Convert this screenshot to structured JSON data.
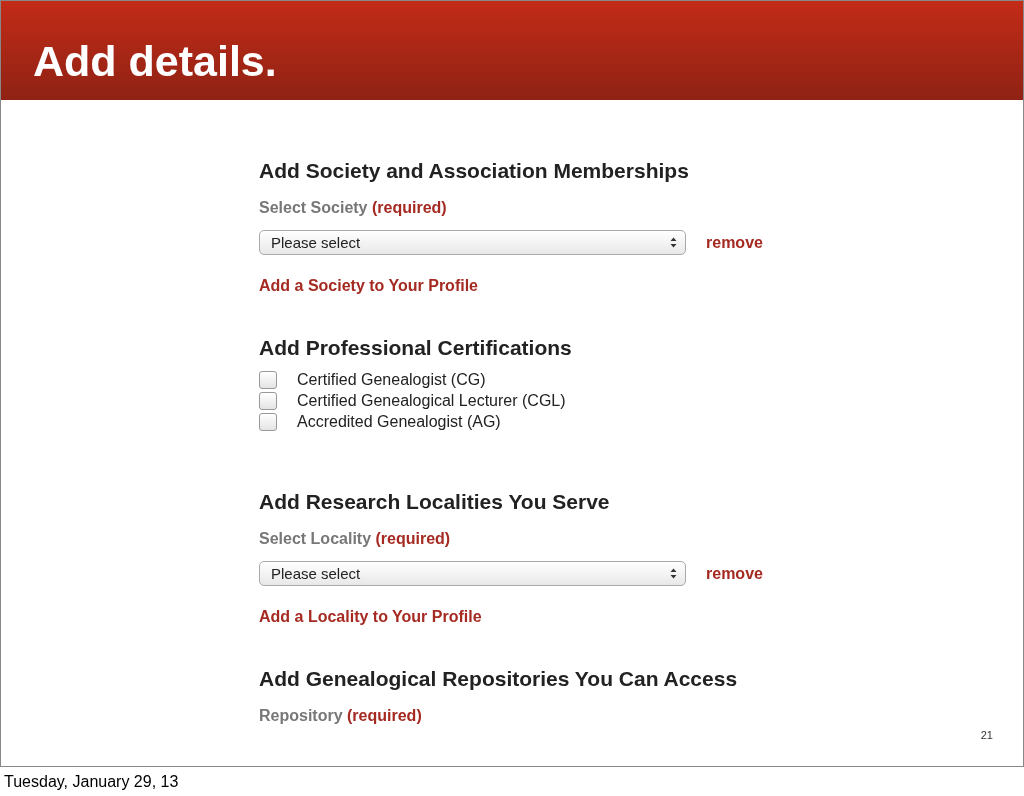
{
  "slide": {
    "title": "Add details.",
    "page_number": "21"
  },
  "sections": [
    {
      "kind": "select",
      "heading": "Add Society and Association Memberships",
      "label": "Select Society",
      "required": "(required)",
      "select": "Please select",
      "remove": "remove",
      "add_link": "Add a Society to Your Profile"
    },
    {
      "kind": "checkboxes",
      "heading": "Add Professional Certifications",
      "items": [
        {
          "label": "Certified Genealogist (CG)",
          "checked": false
        },
        {
          "label": "Certified Genealogical Lecturer (CGL)",
          "checked": false
        },
        {
          "label": "Accredited Genealogist (AG)",
          "checked": false
        }
      ]
    },
    {
      "kind": "select",
      "heading": "Add Research Localities You Serve",
      "label": "Select Locality",
      "required": "(required)",
      "select": "Please select",
      "remove": "remove",
      "add_link": "Add a Locality to Your Profile"
    },
    {
      "kind": "label",
      "heading": "Add Genealogical Repositories You Can Access",
      "label": "Repository",
      "required": "(required)"
    }
  ],
  "footer": {
    "date": "Tuesday, January 29, 13"
  }
}
